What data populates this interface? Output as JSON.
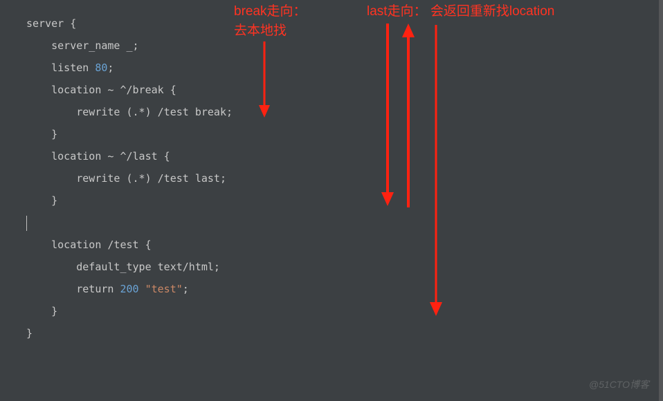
{
  "annotations": {
    "break_label": "break走向：\n去本地找",
    "last_label": "last走向： 会返回重新找location"
  },
  "code": {
    "l1_a": "server {",
    "l2_a": "    server_name _;",
    "l3_a": "    listen ",
    "l3_num": "80",
    "l3_b": ";",
    "l4_a": "    location ~ ^/break {",
    "l5_a": "        rewrite (.*) /test break;",
    "l6_a": "    }",
    "l7_a": "",
    "l8_a": "    location ~ ^/last {",
    "l9_a": "        rewrite (.*) /test last;",
    "l10_a": "    }",
    "l11_a": "",
    "l12_a": "    location /test {",
    "l13_a": "        default_type text/html;",
    "l14_a": "        return ",
    "l14_num": "200",
    "l14_b": " ",
    "l14_str": "\"test\"",
    "l14_c": ";",
    "l15_a": "    }",
    "l16_a": "}"
  },
  "watermark": "@51CTO博客"
}
